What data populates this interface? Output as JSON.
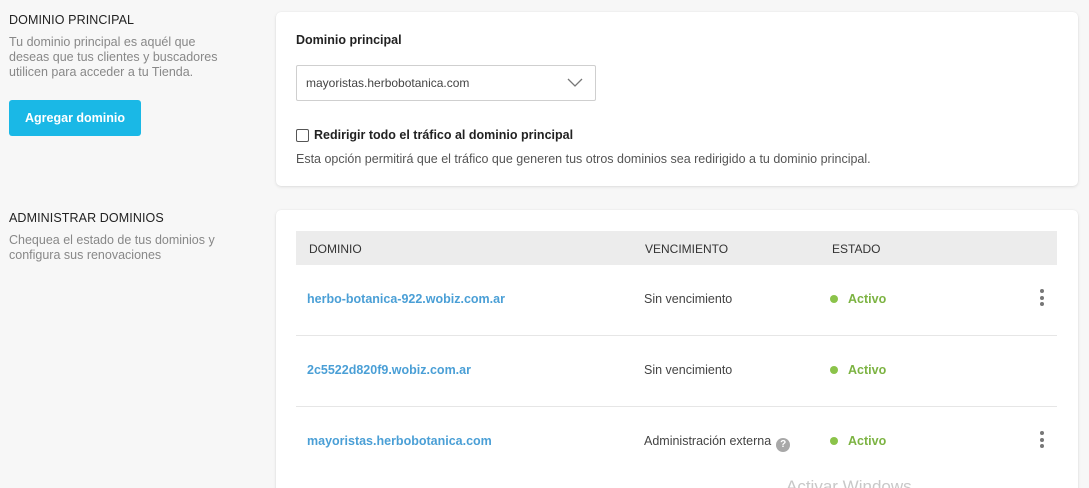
{
  "dominio_principal_section": {
    "title": "DOMINIO PRINCIPAL",
    "description_lines": [
      "Tu dominio principal es aquél que",
      "deseas que tus clientes y buscadores",
      "utilicen para acceder a tu Tienda."
    ],
    "add_button": "Agregar dominio"
  },
  "dominio_card": {
    "field_label": "Dominio principal",
    "selected_domain": "mayoristas.herbobotanica.com",
    "redirect_checkbox": {
      "checked": false,
      "label": "Redirigir todo el tráfico al dominio principal",
      "help": "Esta opción permitirá que el tráfico que generen tus otros dominios sea redirigido a tu dominio principal."
    }
  },
  "administrar_section": {
    "title": "ADMINISTRAR DOMINIOS",
    "description_lines": [
      "Chequea el estado de tus dominios y",
      "configura sus renovaciones"
    ]
  },
  "domains_table": {
    "columns": [
      "DOMINIO",
      "VENCIMIENTO",
      "ESTADO"
    ],
    "rows": [
      {
        "domain": "herbo-botanica-922.wobiz.com.ar",
        "expiry": "Sin vencimiento",
        "status": "Activo",
        "has_help": false,
        "has_menu": true
      },
      {
        "domain": "2c5522d820f9.wobiz.com.ar",
        "expiry": "Sin vencimiento",
        "status": "Activo",
        "has_help": false,
        "has_menu": false
      },
      {
        "domain": "mayoristas.herbobotanica.com",
        "expiry": "Administración externa",
        "status": "Activo",
        "has_help": true,
        "has_menu": true
      }
    ],
    "help_glyph": "?"
  },
  "watermark": "Activar Windows",
  "colors": {
    "accent": "#1ab8e6",
    "link": "#4a9fd6",
    "status_active": "#7cb342"
  }
}
